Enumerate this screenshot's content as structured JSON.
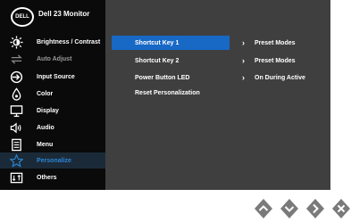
{
  "header": {
    "title": "Dell 23 Monitor",
    "logo_text": "DELL"
  },
  "sidebar": {
    "items": [
      {
        "label": "Brightness / Contrast",
        "icon": "brightness-icon",
        "disabled": false
      },
      {
        "label": "Auto Adjust",
        "icon": "auto-adjust-icon",
        "disabled": true
      },
      {
        "label": "Input Source",
        "icon": "input-source-icon",
        "disabled": false
      },
      {
        "label": "Color",
        "icon": "color-icon",
        "disabled": false
      },
      {
        "label": "Display",
        "icon": "display-icon",
        "disabled": false
      },
      {
        "label": "Audio",
        "icon": "audio-icon",
        "disabled": false
      },
      {
        "label": "Menu",
        "icon": "menu-icon",
        "disabled": false
      },
      {
        "label": "Personalize",
        "icon": "star-icon",
        "disabled": false,
        "active": true
      },
      {
        "label": "Others",
        "icon": "others-icon",
        "disabled": false
      }
    ]
  },
  "submenu": {
    "items": [
      {
        "label": "Shortcut Key 1",
        "value": "Preset Modes",
        "selected": true
      },
      {
        "label": "Shortcut Key 2",
        "value": "Preset Modes",
        "selected": false
      },
      {
        "label": "Power Button LED",
        "value": "On During Active",
        "selected": false
      },
      {
        "label": "Reset Personalization",
        "value": "",
        "selected": false
      }
    ]
  },
  "colors": {
    "accent": "#1868c6",
    "sidebar_bg": "#0a0a0a",
    "main_bg": "#3f3f3f",
    "button_bg": "#7a7a7a"
  },
  "buttons": [
    {
      "icon": "chevron-up-icon"
    },
    {
      "icon": "chevron-down-icon"
    },
    {
      "icon": "chevron-right-icon"
    },
    {
      "icon": "close-icon"
    }
  ]
}
